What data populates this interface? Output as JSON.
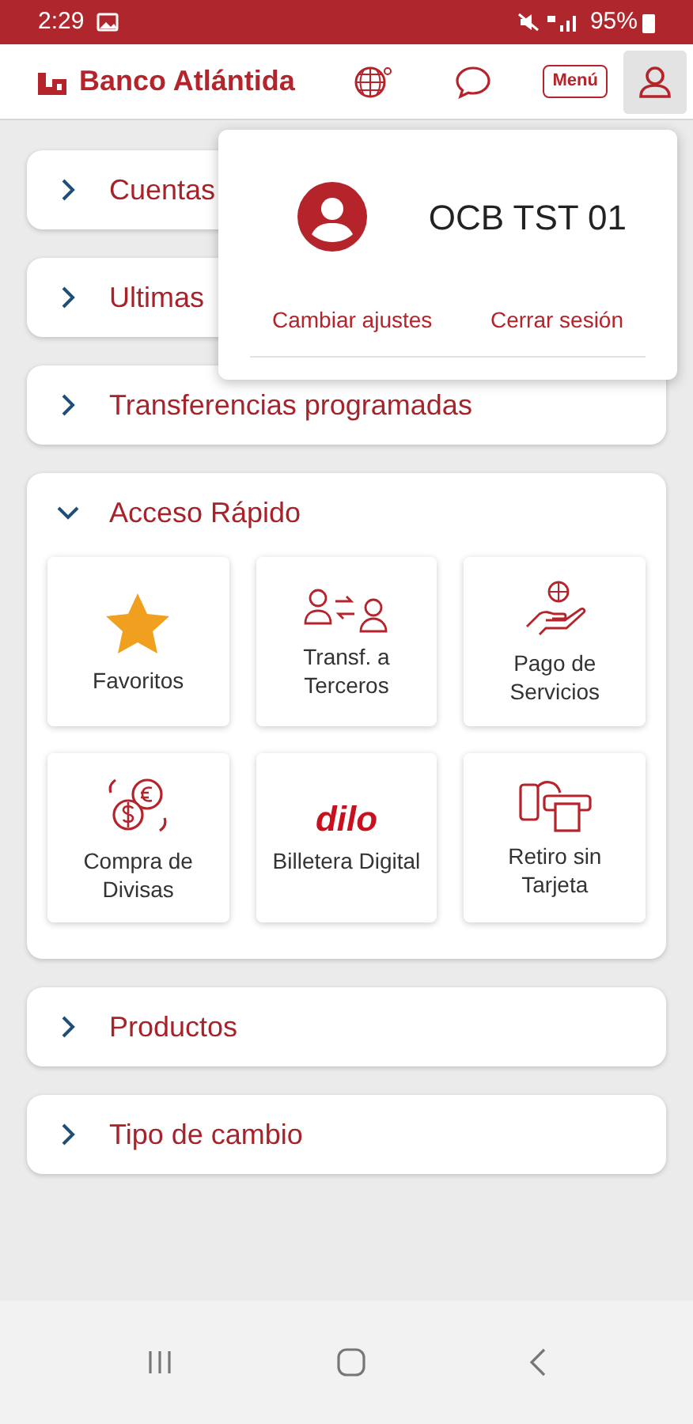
{
  "status_bar": {
    "time": "2:29",
    "battery": "95%"
  },
  "header": {
    "brand": "Banco Atlántida",
    "menu_button": "Menú",
    "user_button_selected": true
  },
  "user_popup": {
    "name": "OCB TST 01",
    "links": [
      "Cambiar ajustes",
      "Cerrar sesión"
    ]
  },
  "sections": [
    {
      "title": "Cuentas",
      "expanded": false
    },
    {
      "title": "Ultimas",
      "expanded": false
    },
    {
      "title": "Transferencias programadas",
      "expanded": false
    },
    {
      "title": "Acceso Rápido",
      "expanded": true,
      "tiles": [
        {
          "kind": "star",
          "label": [
            "Favoritos"
          ]
        },
        {
          "kind": "transfer",
          "label": [
            "Transf. a",
            "Terceros"
          ]
        },
        {
          "kind": "payment",
          "label": [
            "Pago de",
            "Servicios"
          ]
        },
        {
          "kind": "currency",
          "label": [
            "Compra de",
            "Divisas"
          ]
        },
        {
          "kind": "dilo",
          "logo": "dilo",
          "label": [
            "Billetera Digital"
          ]
        },
        {
          "kind": "atm",
          "label": [
            "Retiro sin",
            "Tarjeta"
          ]
        }
      ]
    },
    {
      "title": "Productos",
      "expanded": false
    },
    {
      "title": "Tipo de cambio",
      "expanded": false
    }
  ]
}
